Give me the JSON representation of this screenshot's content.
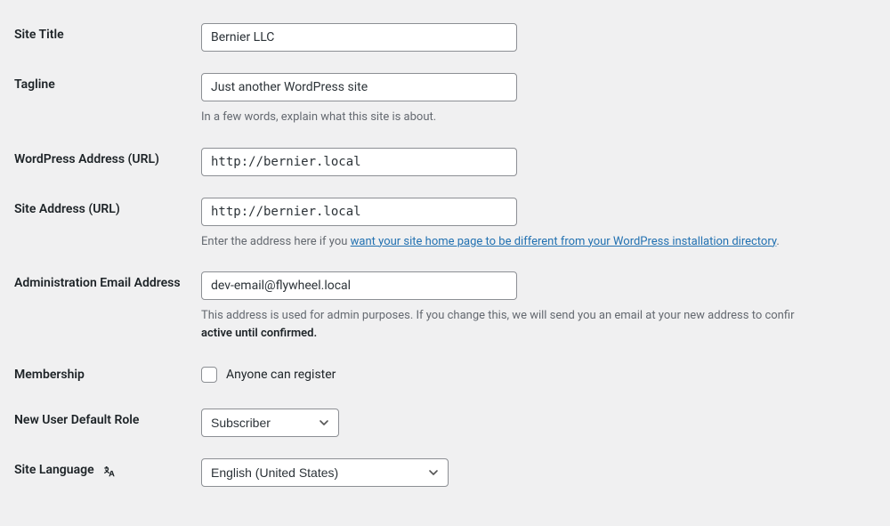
{
  "labels": {
    "site_title": "Site Title",
    "tagline": "Tagline",
    "wp_address": "WordPress Address (URL)",
    "site_address": "Site Address (URL)",
    "admin_email": "Administration Email Address",
    "membership": "Membership",
    "new_user_role": "New User Default Role",
    "site_language": "Site Language"
  },
  "values": {
    "site_title": "Bernier LLC",
    "tagline": "Just another WordPress site",
    "wp_address": "http://bernier.local",
    "site_address": "http://bernier.local",
    "admin_email": "dev-email@flywheel.local",
    "role_selected": "Subscriber",
    "lang_selected": "English (United States)"
  },
  "descriptions": {
    "tagline": "In a few words, explain what this site is about.",
    "site_address_pre": "Enter the address here if you ",
    "site_address_link": "want your site home page to be different from your WordPress installation directory",
    "site_address_post": ".",
    "admin_email_pre": "This address is used for admin purposes. If you change this, we will send you an email at your new address to confir",
    "admin_email_bold": "active until confirmed."
  },
  "membership_checkbox_label": "Anyone can register"
}
